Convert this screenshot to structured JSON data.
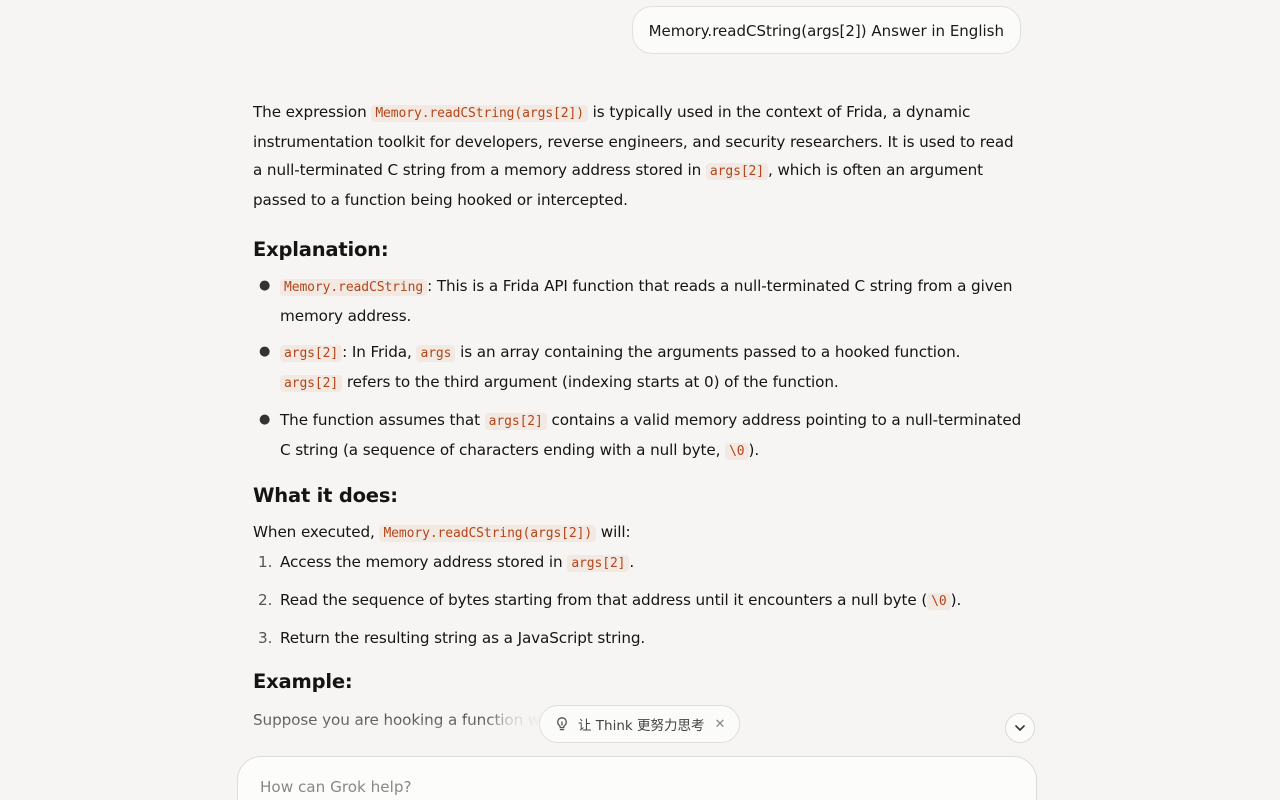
{
  "user_message": "Memory.readCString(args[2]) Answer in English",
  "answer": {
    "intro": {
      "t1": "The expression ",
      "c1": "Memory.readCString(args[2])",
      "t2": " is typically used in the context of Frida, a dynamic instrumentation toolkit for developers, reverse engineers, and security researchers. It is used to read a null-terminated C string from a memory address stored in ",
      "c2": "args[2]",
      "t3": ", which is often an argument passed to a function being hooked or intercepted."
    },
    "explanation_heading": "Explanation:",
    "explanation_items": [
      {
        "c1": "Memory.readCString",
        "t1": ": This is a Frida API function that reads a null-terminated C string from a given memory address."
      },
      {
        "c1": "args[2]",
        "t1": ": In Frida, ",
        "c2": "args",
        "t2": " is an array containing the arguments passed to a hooked function. ",
        "c3": "args[2]",
        "t3": " refers to the third argument (indexing starts at 0) of the function."
      },
      {
        "t1": "The function assumes that ",
        "c1": "args[2]",
        "t2": " contains a valid memory address pointing to a null-terminated C string (a sequence of characters ending with a null byte, ",
        "c2": "\\0",
        "t3": ")."
      }
    ],
    "what_heading": "What it does:",
    "when": {
      "t1": "When executed, ",
      "c1": "Memory.readCString(args[2])",
      "t2": " will:"
    },
    "steps": [
      {
        "n": "1.",
        "t1": "Access the memory address stored in ",
        "c1": "args[2]",
        "t2": "."
      },
      {
        "n": "2.",
        "t1": "Read the sequence of bytes starting from that address until it encounters a null byte (",
        "c1": "\\0",
        "t2": ")."
      },
      {
        "n": "3.",
        "t1": "Return the resulting string as a JavaScript string."
      }
    ],
    "example_heading": "Example:",
    "example_text": "Suppose you are hooking a ",
    "example_text_faded": "function wi"
  },
  "think_pill": {
    "label": "让 Think 更努力思考",
    "icon": "lightbulb-icon",
    "close_icon": "close-icon"
  },
  "scroll_button": {
    "icon": "chevron-down-icon"
  },
  "input": {
    "placeholder": "How can Grok help?"
  }
}
